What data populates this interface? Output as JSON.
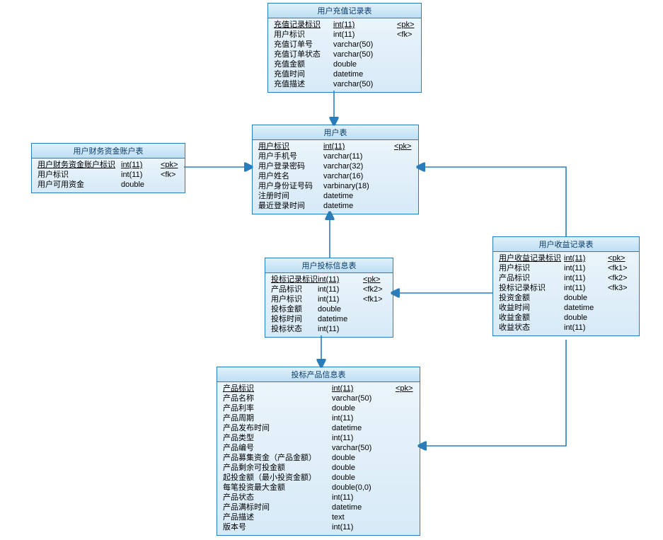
{
  "diagram_type": "er-diagram",
  "entities": {
    "recharge": {
      "title": "用户充值记录表",
      "fields": [
        {
          "name": "充值记录标识",
          "type": "int(11)",
          "key": "<pk>",
          "pk": true
        },
        {
          "name": "用户标识",
          "type": "int(11)",
          "key": "<fk>"
        },
        {
          "name": "充值订单号",
          "type": "varchar(50)"
        },
        {
          "name": "充值订单状态",
          "type": "varchar(50)"
        },
        {
          "name": "充值金额",
          "type": "double"
        },
        {
          "name": "充值时间",
          "type": "datetime"
        },
        {
          "name": "充值描述",
          "type": "varchar(50)"
        }
      ]
    },
    "user": {
      "title": "用户表",
      "fields": [
        {
          "name": "用户标识",
          "type": "int(11)",
          "key": "<pk>",
          "pk": true
        },
        {
          "name": "用户手机号",
          "type": "varchar(11)"
        },
        {
          "name": "用户登录密码",
          "type": "varchar(32)"
        },
        {
          "name": "用户姓名",
          "type": "varchar(16)"
        },
        {
          "name": "用户身份证号码",
          "type": "varbinary(18)"
        },
        {
          "name": "注册时间",
          "type": "datetime"
        },
        {
          "name": "最近登录时间",
          "type": "datetime"
        }
      ]
    },
    "account": {
      "title": "用户财务资金账户表",
      "fields": [
        {
          "name": "用户财务资金账户标识",
          "type": "int(11)",
          "key": "<pk>",
          "pk": true
        },
        {
          "name": "用户标识",
          "type": "int(11)",
          "key": "<fk>"
        },
        {
          "name": "用户可用资金",
          "type": "double"
        }
      ]
    },
    "bid": {
      "title": "用户投标信息表",
      "fields": [
        {
          "name": "投标记录标识",
          "type": "int(11)",
          "key": "<pk>",
          "pk": true
        },
        {
          "name": "产品标识",
          "type": "int(11)",
          "key": "<fk2>"
        },
        {
          "name": "用户标识",
          "type": "int(11)",
          "key": "<fk1>"
        },
        {
          "name": "投标金额",
          "type": "double"
        },
        {
          "name": "投标时间",
          "type": "datetime"
        },
        {
          "name": "投标状态",
          "type": "int(11)"
        }
      ]
    },
    "income": {
      "title": "用户收益记录表",
      "fields": [
        {
          "name": "用户收益记录标识",
          "type": "int(11)",
          "key": "<pk>",
          "pk": true
        },
        {
          "name": "用户标识",
          "type": "int(11)",
          "key": "<fk1>"
        },
        {
          "name": "产品标识",
          "type": "int(11)",
          "key": "<fk2>"
        },
        {
          "name": "投标记录标识",
          "type": "int(11)",
          "key": "<fk3>"
        },
        {
          "name": "投资金额",
          "type": "double"
        },
        {
          "name": "收益时间",
          "type": "datetime"
        },
        {
          "name": "收益金额",
          "type": "double"
        },
        {
          "name": "收益状态",
          "type": "int(11)"
        }
      ]
    },
    "product": {
      "title": "投标产品信息表",
      "fields": [
        {
          "name": "产品标识",
          "type": "int(11)",
          "key": "<pk>",
          "pk": true
        },
        {
          "name": "产品名称",
          "type": "varchar(50)"
        },
        {
          "name": "产品利率",
          "type": "double"
        },
        {
          "name": "产品周期",
          "type": "int(11)"
        },
        {
          "name": "产品发布时间",
          "type": "datetime"
        },
        {
          "name": "产品类型",
          "type": "int(11)"
        },
        {
          "name": "产品编号",
          "type": "varchar(50)"
        },
        {
          "name": "产品募集资金（产品金额）",
          "type": "double"
        },
        {
          "name": "产品剩余可投金额",
          "type": "double"
        },
        {
          "name": "起投金额（最小投资金额）",
          "type": "double"
        },
        {
          "name": "每笔投资最大金额",
          "type": "double(0,0)"
        },
        {
          "name": "产品状态",
          "type": "int(11)"
        },
        {
          "name": "产品满标时间",
          "type": "datetime"
        },
        {
          "name": "产品描述",
          "type": "text"
        },
        {
          "name": "版本号",
          "type": "int(11)"
        }
      ]
    }
  },
  "relationships": [
    {
      "from": "recharge",
      "to": "user"
    },
    {
      "from": "account",
      "to": "user"
    },
    {
      "from": "bid",
      "to": "user"
    },
    {
      "from": "bid",
      "to": "product"
    },
    {
      "from": "income",
      "to": "user"
    },
    {
      "from": "income",
      "to": "bid"
    },
    {
      "from": "income",
      "to": "product"
    }
  ]
}
